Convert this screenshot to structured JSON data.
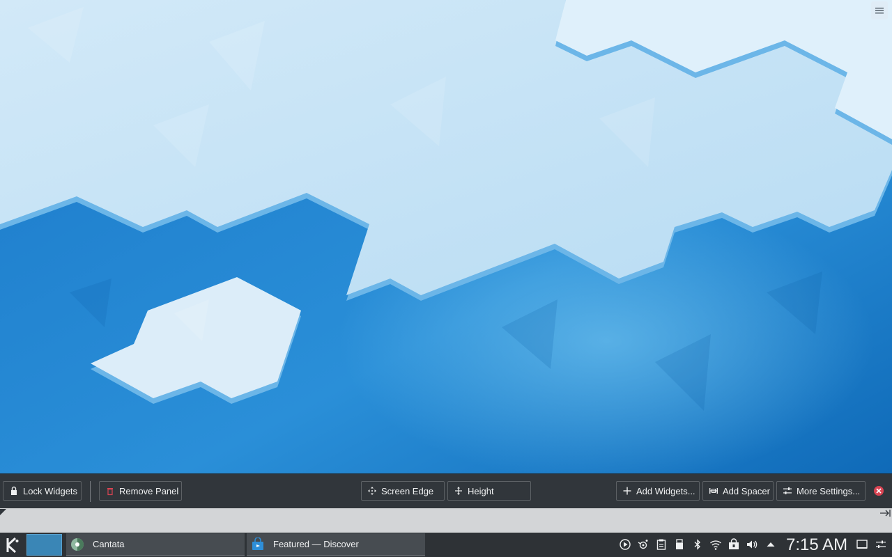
{
  "panel_config": {
    "lock_widgets": "Lock Widgets",
    "remove_panel": "Remove Panel",
    "screen_edge": "Screen Edge",
    "height": "Height",
    "add_widgets": "Add Widgets...",
    "add_spacer": "Add Spacer",
    "more_settings": "More Settings..."
  },
  "taskbar": {
    "tasks": [
      {
        "label": "Cantata",
        "icon": "cantata-icon"
      },
      {
        "label": "Featured — Discover",
        "icon": "discover-icon"
      }
    ],
    "clock": "7:15 AM",
    "tray_icons": [
      "media-player-icon",
      "kde-connect-icon",
      "clipboard-icon",
      "usb-device-icon",
      "bluetooth-icon",
      "wifi-icon",
      "updates-icon",
      "volume-icon",
      "expand-tray-icon",
      "show-desktop-icon",
      "panel-settings-icon"
    ]
  },
  "colors": {
    "accent": "#3daee9",
    "toolbar_bg": "#31363b",
    "taskbar_bg": "#2e3236",
    "close_red": "#da4453"
  }
}
